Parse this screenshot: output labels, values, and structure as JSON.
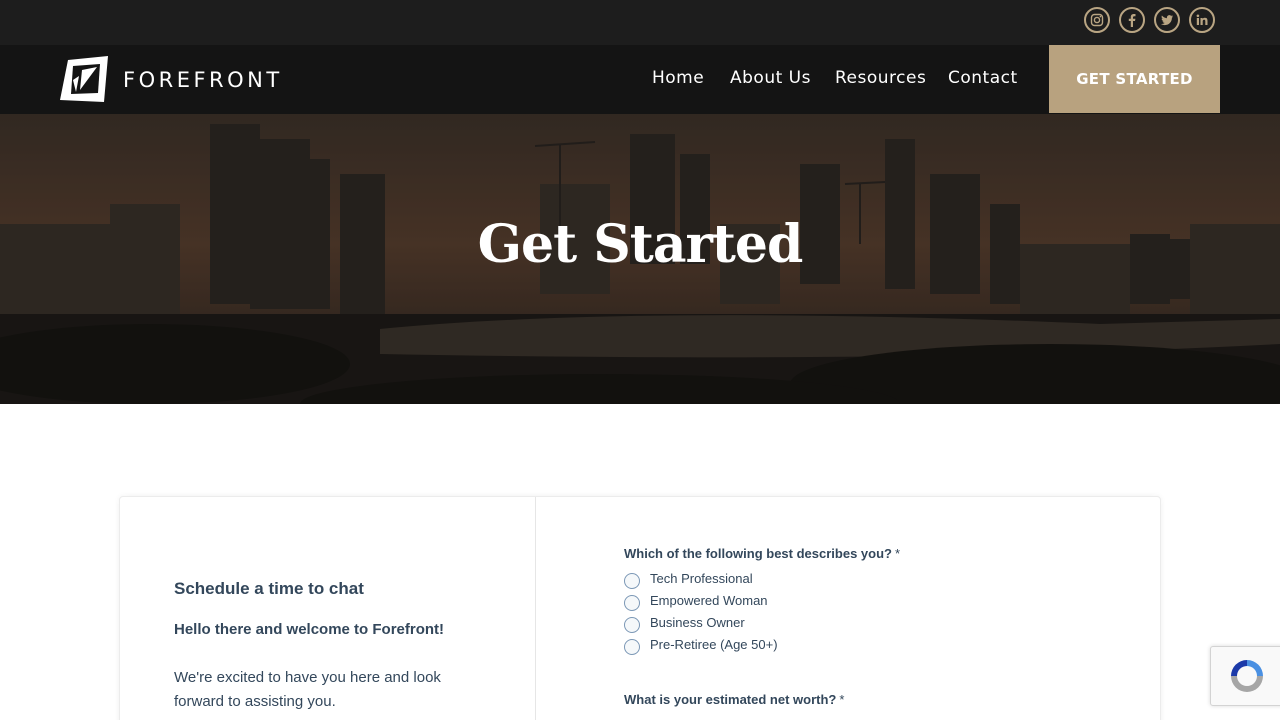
{
  "social": {
    "icons": [
      "instagram-icon",
      "facebook-icon",
      "twitter-icon",
      "linkedin-icon"
    ]
  },
  "brand": {
    "name": "FOREFRONT"
  },
  "nav": {
    "items": [
      "Home",
      "About Us",
      "Resources",
      "Contact"
    ],
    "cta_label": "GET STARTED"
  },
  "hero": {
    "title": "Get Started"
  },
  "card": {
    "schedule_title": "Schedule a time to chat",
    "hello": "Hello there and welcome to Forefront!",
    "excited": "We're excited to have you here and look forward to assisting you."
  },
  "form": {
    "q1": {
      "label": "Which of the following best describes you?",
      "required_mark": "*",
      "options": [
        "Tech Professional",
        "Empowered Woman",
        "Business Owner",
        "Pre-Retiree (Age 50+)"
      ]
    },
    "q2": {
      "label": "What is your estimated net worth?",
      "required_mark": "*"
    }
  },
  "colors": {
    "accent": "#b8a27f",
    "topbar": "#1d1d1d",
    "navbar": "#141414",
    "text": "#33475b"
  }
}
